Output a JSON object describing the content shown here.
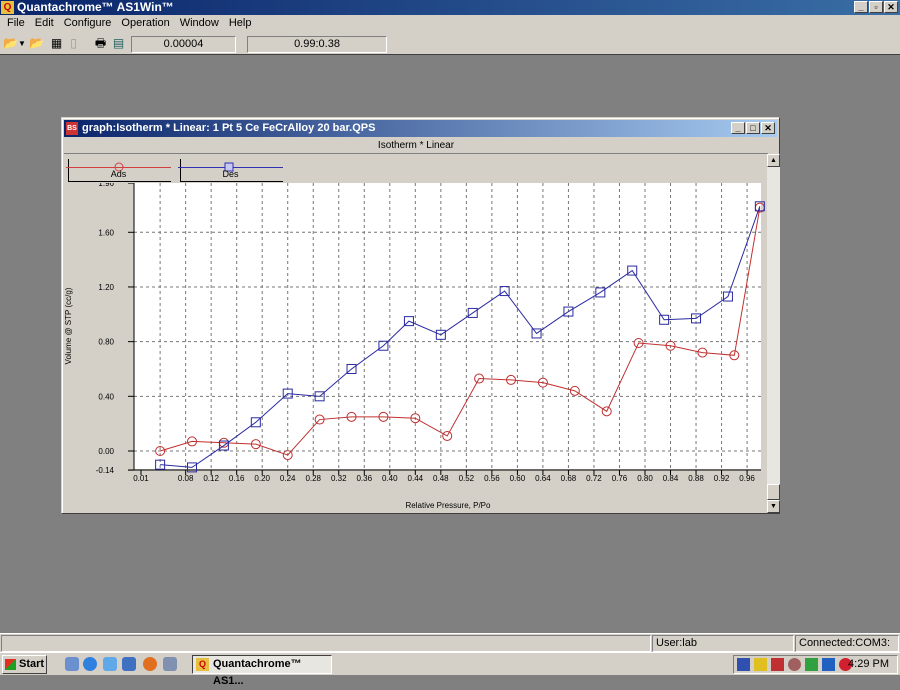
{
  "app": {
    "title": "Quantachrome™ AS1Win™"
  },
  "menu": [
    "File",
    "Edit",
    "Configure",
    "Operation",
    "Window",
    "Help"
  ],
  "toolbar": {
    "field1": "0.00004",
    "field2": "0.99:0.38"
  },
  "child": {
    "title": "graph:Isotherm *  Linear: 1 Pt 5 Ce FeCrAlloy 20 bar.QPS",
    "subtitle": "Isotherm *  Linear"
  },
  "status": {
    "user": "User:lab",
    "connection": "Connected:COM3:"
  },
  "taskbar": {
    "start": "Start",
    "task": "Quantachrome™ AS1...",
    "clock": "4:29 PM"
  },
  "chart_data": {
    "type": "line",
    "xlabel": "Relative Pressure, P/Po",
    "ylabel": "Volume @ STP (cc/g)",
    "xlim": [
      0,
      0.985
    ],
    "ylim": [
      -0.14,
      1.96
    ],
    "xticks": [
      "0.01",
      "0.08",
      "0.12",
      "0.16",
      "0.20",
      "0.24",
      "0.28",
      "0.32",
      "0.36",
      "0.40",
      "0.44",
      "0.48",
      "0.52",
      "0.56",
      "0.60",
      "0.64",
      "0.68",
      "0.72",
      "0.76",
      "0.80",
      "0.84",
      "0.88",
      "0.92",
      "0.96"
    ],
    "yticks": [
      "1.96",
      "1.60",
      "1.20",
      "0.80",
      "0.40",
      "0.00",
      "-0.14"
    ],
    "grid": true,
    "legend_position": "top-left",
    "series": [
      {
        "name": "Ads",
        "color": "#c03030",
        "marker": "circle",
        "x": [
          0.04,
          0.09,
          0.14,
          0.19,
          0.24,
          0.29,
          0.34,
          0.39,
          0.44,
          0.49,
          0.54,
          0.59,
          0.64,
          0.69,
          0.74,
          0.79,
          0.84,
          0.89,
          0.94,
          0.98
        ],
        "y": [
          0.0,
          0.07,
          0.06,
          0.05,
          -0.03,
          0.23,
          0.25,
          0.25,
          0.24,
          0.11,
          0.53,
          0.52,
          0.5,
          0.44,
          0.29,
          0.79,
          0.77,
          0.72,
          0.7,
          1.78
        ]
      },
      {
        "name": "Des",
        "color": "#2a2aa0",
        "marker": "square",
        "x": [
          0.04,
          0.09,
          0.14,
          0.19,
          0.24,
          0.29,
          0.34,
          0.39,
          0.43,
          0.48,
          0.53,
          0.58,
          0.63,
          0.68,
          0.73,
          0.78,
          0.83,
          0.88,
          0.93,
          0.98
        ],
        "y": [
          -0.1,
          -0.12,
          0.04,
          0.21,
          0.42,
          0.4,
          0.6,
          0.77,
          0.95,
          0.85,
          1.01,
          1.17,
          0.86,
          1.02,
          1.16,
          1.32,
          0.96,
          0.97,
          1.13,
          1.79
        ]
      }
    ]
  }
}
